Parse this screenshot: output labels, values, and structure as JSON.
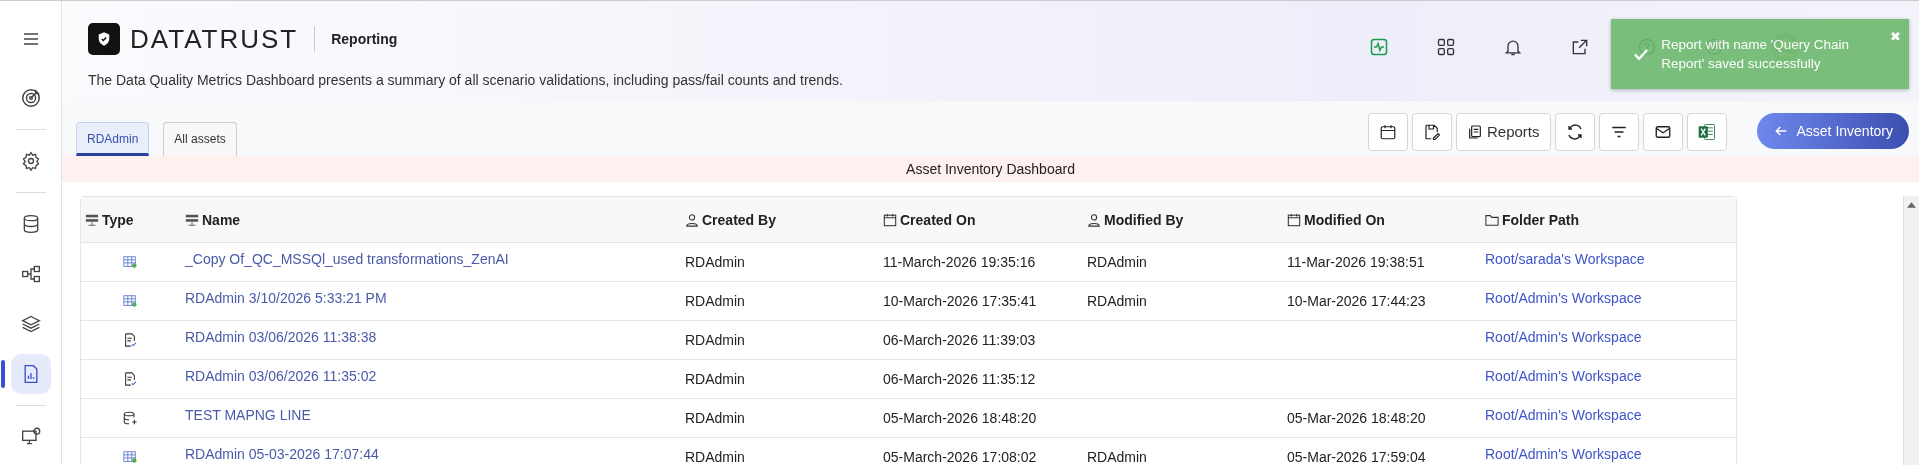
{
  "sidebar": {
    "items": [
      {
        "selected": false
      },
      {
        "selected": false
      },
      {
        "selected": false
      },
      {
        "selected": false
      },
      {
        "selected": false
      },
      {
        "selected": true
      },
      {
        "selected": false
      }
    ]
  },
  "header": {
    "logo": "DATATRUST",
    "page": "Reporting",
    "description": "The Data Quality Metrics Dashboard presents a summary of all scenario validations, including pass/fail counts and trends."
  },
  "toast": {
    "message": "Report with name 'Query Chain Report' saved successfully",
    "close": "✖"
  },
  "tabs": [
    {
      "label": "RDAdmin",
      "selected": true
    },
    {
      "label": "All assets",
      "selected": false
    }
  ],
  "toolbar": {
    "reports": "Reports",
    "back": "Asset Inventory"
  },
  "banner": "Asset Inventory Dashboard",
  "table": {
    "columns": [
      {
        "label": "Type"
      },
      {
        "label": "Name"
      },
      {
        "label": "Created By"
      },
      {
        "label": "Created On"
      },
      {
        "label": "Modified By"
      },
      {
        "label": "Modified On"
      },
      {
        "label": "Folder Path"
      }
    ],
    "rows": [
      {
        "kind": "grid",
        "name": "_Copy Of_QC_MSSQl_used transformations_ZenAI",
        "created_by": "RDAdmin",
        "created_on": "11-March-2026 19:35:16",
        "modified_by": "RDAdmin",
        "modified_on": "11-Mar-2026 19:38:51",
        "folder": "Root/sarada's Workspace"
      },
      {
        "kind": "grid",
        "name": "RDAdmin 3/10/2026 5:33:21 PM",
        "created_by": "RDAdmin",
        "created_on": "10-March-2026 17:35:41",
        "modified_by": "RDAdmin",
        "modified_on": "10-Mar-2026 17:44:23",
        "folder": "Root/Admin's Workspace"
      },
      {
        "kind": "report",
        "name": "RDAdmin 03/06/2026 11:38:38",
        "created_by": "RDAdmin",
        "created_on": "06-March-2026 11:39:03",
        "folder": "Root/Admin's Workspace"
      },
      {
        "kind": "report",
        "name": "RDAdmin 03/06/2026 11:35:02",
        "created_by": "RDAdmin",
        "created_on": "06-March-2026 11:35:12",
        "folder": "Root/Admin's Workspace"
      },
      {
        "kind": "dbadd",
        "name": "TEST MAPNG LINE",
        "created_by": "RDAdmin",
        "created_on": "05-March-2026 18:48:20",
        "modified_on": "05-Mar-2026 18:48:20",
        "folder": "Root/Admin's Workspace"
      },
      {
        "kind": "grid",
        "name": "RDAdmin 05-03-2026 17:07:44",
        "created_by": "RDAdmin",
        "created_on": "05-March-2026 17:08:02",
        "modified_by": "RDAdmin",
        "modified_on": "05-Mar-2026 17:59:04",
        "folder": "Root/Admin's Workspace"
      }
    ]
  }
}
